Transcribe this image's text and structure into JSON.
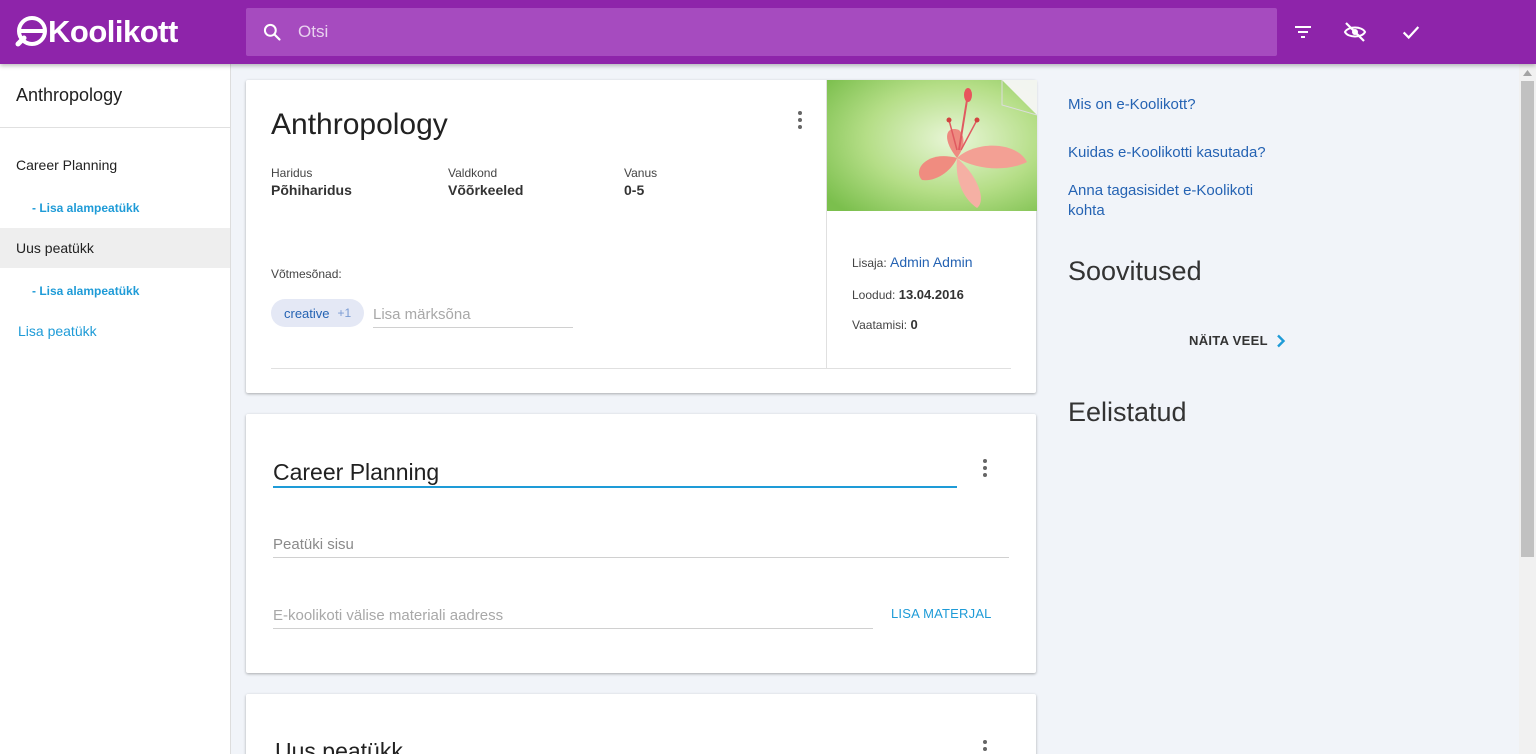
{
  "header": {
    "logo_text": "Koolikott",
    "search_placeholder": "Otsi",
    "icons": [
      "filter-icon",
      "visibility-off-icon",
      "check-icon"
    ],
    "brand_color": "#8e24aa"
  },
  "sidebar": {
    "title": "Anthropology",
    "items": [
      {
        "label": "Career Planning",
        "sub_label": "- Lisa alampeatükk",
        "active": false
      },
      {
        "label": "Uus peatükk",
        "sub_label": "- Lisa alampeatükk",
        "active": true
      }
    ],
    "add_chapter": "Lisa peatükk"
  },
  "material": {
    "title": "Anthropology",
    "meta": [
      {
        "label": "Haridus",
        "value": "Põhiharidus"
      },
      {
        "label": "Valdkond",
        "value": "Võõrkeeled"
      },
      {
        "label": "Vanus",
        "value": "0-5"
      }
    ],
    "keywords_label": "Võtmesõnad:",
    "keyword_chip": "creative",
    "keyword_more": "+1",
    "keyword_placeholder": "Lisa märksõna",
    "added_by_label": "Lisaja:",
    "added_by": "Admin Admin",
    "created_label": "Loodud:",
    "created": "13.04.2016",
    "views_label": "Vaatamisi:",
    "views": "0"
  },
  "chapters": [
    {
      "title": "Career Planning",
      "body_placeholder": "Peatüki sisu",
      "material_placeholder": "E-koolikoti välise materiali aadress",
      "add_material": "LISA MATERJAL"
    },
    {
      "title": "Uus peatükk"
    }
  ],
  "right": {
    "links": [
      "Mis on e-Koolikott?",
      "Kuidas e-Koolikotti kasutada?",
      "Anna tagasisidet e-Koolikoti kohta"
    ],
    "recommendations_title": "Soovitused",
    "show_more": "NÄITA VEEL",
    "favorites_title": "Eelistatud"
  }
}
